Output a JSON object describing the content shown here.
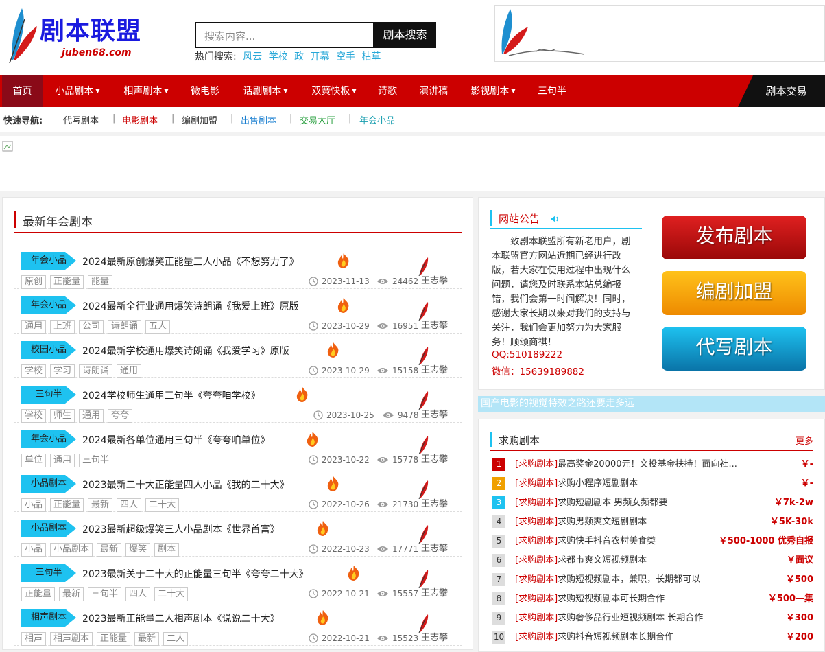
{
  "logo": {
    "title": "剧本联盟",
    "sub": "juben68.com"
  },
  "search": {
    "placeholder": "搜索内容...",
    "button": "剧本搜索",
    "hot_label": "热门搜索:",
    "hot_terms": [
      "风云",
      "学校",
      "政",
      "开幕",
      "空手",
      "枯草"
    ]
  },
  "nav": {
    "items": [
      {
        "label": "首页",
        "caret": ""
      },
      {
        "label": "小品剧本",
        "caret": "▼"
      },
      {
        "label": "相声剧本",
        "caret": "▼"
      },
      {
        "label": "微电影",
        "caret": ""
      },
      {
        "label": "话剧剧本",
        "caret": "▼"
      },
      {
        "label": "双簧快板",
        "caret": "▼"
      },
      {
        "label": "诗歌",
        "caret": ""
      },
      {
        "label": "演讲稿",
        "caret": ""
      },
      {
        "label": "影视剧本",
        "caret": "▼"
      },
      {
        "label": "三句半",
        "caret": ""
      }
    ],
    "deal": "剧本交易"
  },
  "quick": {
    "label": "快速导航:",
    "items": [
      {
        "label": "代写剧本",
        "color": "#333333"
      },
      {
        "label": "电影剧本",
        "color": "#cc0000"
      },
      {
        "label": "编剧加盟",
        "color": "#333333"
      },
      {
        "label": "出售剧本",
        "color": "#1a7fd0"
      },
      {
        "label": "交易大厅",
        "color": "#2aa040"
      },
      {
        "label": "年会小品",
        "color": "#1a9fb0"
      }
    ]
  },
  "latest": {
    "title": "最新年会剧本",
    "author": "王志攀",
    "rows": [
      {
        "cat": "年会小品",
        "title": "2024最新原创爆笑正能量三人小品《不想努力了》",
        "tags": [
          "原创",
          "正能量",
          "能量"
        ],
        "date": "2023-11-13",
        "views": "24462"
      },
      {
        "cat": "年会小品",
        "title": "2024最新全行业通用爆笑诗朗诵《我爱上班》原版",
        "tags": [
          "通用",
          "上班",
          "公司",
          "诗朗诵",
          "五人"
        ],
        "date": "2023-10-29",
        "views": "16951"
      },
      {
        "cat": "校园小品",
        "title": "2024最新学校通用爆笑诗朗诵《我爱学习》原版",
        "tags": [
          "学校",
          "学习",
          "诗朗诵",
          "通用"
        ],
        "date": "2023-10-29",
        "views": "15158"
      },
      {
        "cat": "三句半",
        "title": "2024学校师生通用三句半《夸夸咱学校》",
        "tags": [
          "学校",
          "师生",
          "通用",
          "夸夸"
        ],
        "date": "2023-10-25",
        "views": "9478"
      },
      {
        "cat": "年会小品",
        "title": "2024最新各单位通用三句半《夸夸咱单位》",
        "tags": [
          "单位",
          "通用",
          "三句半"
        ],
        "date": "2023-10-22",
        "views": "15778"
      },
      {
        "cat": "小品剧本",
        "title": "2023最新二十大正能量四人小品《我的二十大》",
        "tags": [
          "小品",
          "正能量",
          "最新",
          "四人",
          "二十大"
        ],
        "date": "2022-10-26",
        "views": "21730"
      },
      {
        "cat": "小品剧本",
        "title": "2023最新超级爆笑三人小品剧本《世界首富》",
        "tags": [
          "小品",
          "小品剧本",
          "最新",
          "爆笑",
          "剧本"
        ],
        "date": "2022-10-23",
        "views": "17771"
      },
      {
        "cat": "三句半",
        "title": "2023最新关于二十大的正能量三句半《夸夸二十大》",
        "tags": [
          "正能量",
          "最新",
          "三句半",
          "四人",
          "二十大"
        ],
        "date": "2022-10-21",
        "views": "15557"
      },
      {
        "cat": "相声剧本",
        "title": "2023最新正能量二人相声剧本《说说二十大》",
        "tags": [
          "相声",
          "相声剧本",
          "正能量",
          "最新",
          "二人"
        ],
        "date": "2022-10-21",
        "views": "15523"
      }
    ]
  },
  "notice": {
    "title": "网站公告",
    "body": "致剧本联盟所有新老用户，剧本联盟官方网站近期已经进行改版，若大家在使用过程中出现什么问题，请您及时联系本站总编报错，我们会第一时间解决！同时，感谢大家长期以来对我们的支持与关注，我们会更加努力为大家服务！顺颂商祺！",
    "qq": "QQ:510189222",
    "wx": "微信：15639189882"
  },
  "buttons": {
    "publish": "发布剧本",
    "join": "编剧加盟",
    "write": "代写剧本"
  },
  "strip": {
    "text": "国产电影的视觉特效之路还要走多远"
  },
  "buy": {
    "title": "求购剧本",
    "more": "更多",
    "prefix": "[求购剧本]",
    "rows": [
      {
        "num": "1",
        "text": "最高奖金20000元！文投基金扶持！面向社...",
        "price": "￥-"
      },
      {
        "num": "2",
        "text": "求购小程序短剧剧本",
        "price": "￥-"
      },
      {
        "num": "3",
        "text": "求购短剧剧本 男频女频都要",
        "price": "￥7k-2w"
      },
      {
        "num": "4",
        "text": "求购男频爽文短剧剧本",
        "price": "￥5K-30k"
      },
      {
        "num": "5",
        "text": "求购快手抖音农村美食类",
        "price": "￥500-1000 优秀自报"
      },
      {
        "num": "6",
        "text": "求都市爽文短视频剧本",
        "price": "￥面议"
      },
      {
        "num": "7",
        "text": "求购短视频剧本，兼职，长期都可以",
        "price": "￥500"
      },
      {
        "num": "8",
        "text": "求购短视频剧本可长期合作",
        "price": "￥500—集"
      },
      {
        "num": "9",
        "text": "求购奢侈品行业短视频剧本 长期合作",
        "price": "￥300"
      },
      {
        "num": "10",
        "text": "求购抖音短视频剧本长期合作",
        "price": "￥200"
      }
    ]
  },
  "colors": {
    "brand": "#cc0000",
    "accent": "#1ec2f0",
    "nav_active": "#8a0a18"
  }
}
